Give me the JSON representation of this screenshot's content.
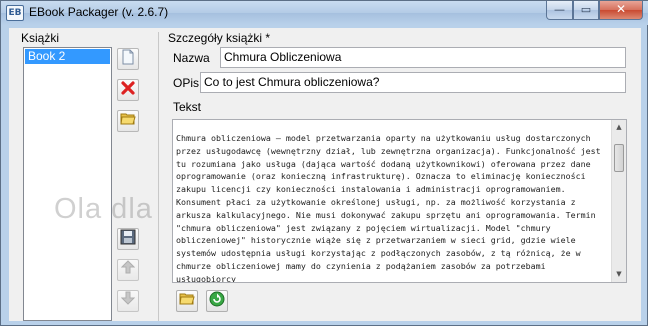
{
  "window": {
    "title": "EBook Packager (v. 2.6.7)"
  },
  "caption_buttons": {
    "minimize": "—",
    "maximize": "▭",
    "close": "✕"
  },
  "left_panel": {
    "label": "Książki",
    "items": [
      "Book 2"
    ]
  },
  "left_toolbar_icons": [
    "document-new-icon",
    "delete-icon",
    "folder-open-icon",
    "save-icon",
    "arrow-up-icon",
    "arrow-down-icon"
  ],
  "details": {
    "label": "Szczegóły książki *",
    "name_label": "Nazwa",
    "name_value": "Chmura Obliczeniowa",
    "desc_label": "OPis",
    "desc_value": "Co to jest Chmura obliczeniowa?",
    "text_label": "Tekst",
    "text_value": "Chmura obliczeniowa – model przetwarzania oparty na użytkowaniu usług dostarczonych przez usługodawcę (wewnętrzny dział, lub zewnętrzna organizacja). Funkcjonalność jest tu rozumiana jako usługa (dająca wartość dodaną użytkownikowi) oferowana przez dane oprogramowanie (oraz konieczną infrastrukturę). Oznacza to eliminację konieczności zakupu licencji czy konieczności instalowania i administracji oprogramowaniem. Konsument płaci za użytkowanie określonej usługi, np. za możliwość korzystania z arkusza kalkulacyjnego. Nie musi dokonywać zakupu sprzętu ani oprogramowania. Termin \"chmura obliczeniowa\" jest związany z pojęciem wirtualizacji. Model \"chmury obliczeniowej\" historycznie wiąże się z przetwarzaniem w sieci grid, gdzie wiele systemów udostępnia usługi korzystając z podłączonych zasobów, z tą różnicą, że w chmurze obliczeniowej mamy do czynienia z podążaniem zasobów za potrzebami usługobiorcy"
  },
  "watermark": "Ola dla",
  "bottom_toolbar_icons": [
    "folder-open-icon",
    "refresh-icon"
  ]
}
